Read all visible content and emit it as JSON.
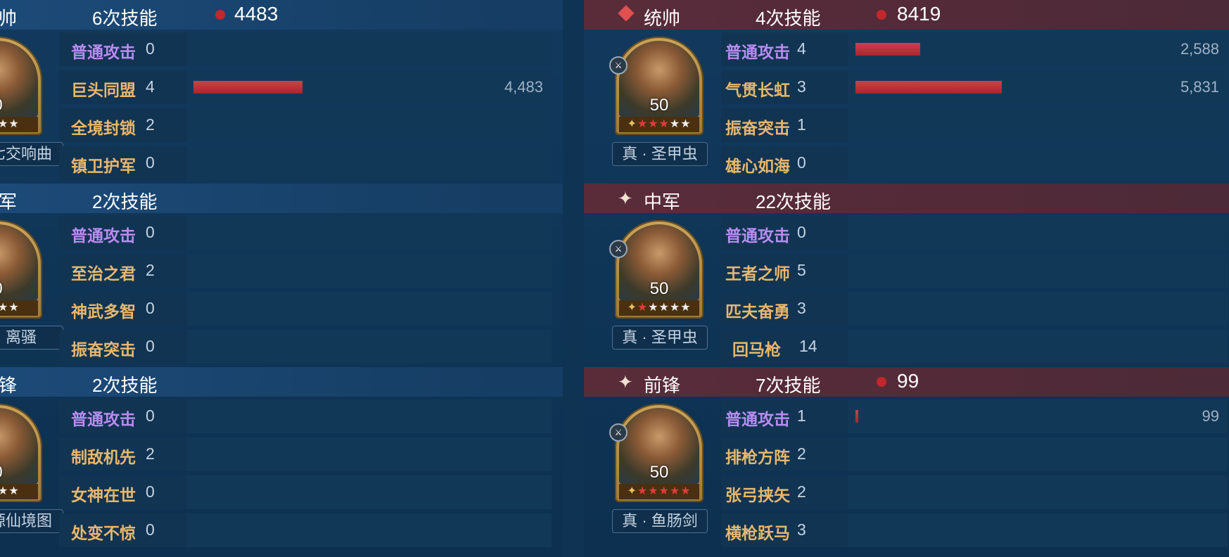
{
  "left": {
    "teams": [
      {
        "role": "帅",
        "skill_count": "6次技能",
        "damage": "4483",
        "level": "0",
        "stars": [
          true,
          true,
          false,
          false
        ],
        "treasure": "七交响曲",
        "skills": [
          {
            "name": "普通攻击",
            "type": "normal",
            "count": "0",
            "bar": 0,
            "value": ""
          },
          {
            "name": "巨头同盟",
            "type": "tactic",
            "count": "4",
            "bar": 0.177,
            "value": "4,483"
          },
          {
            "name": "全境封锁",
            "type": "tactic",
            "count": "2",
            "bar": 0,
            "value": ""
          },
          {
            "name": "镇卫护军",
            "type": "tactic",
            "count": "0",
            "bar": 0,
            "value": ""
          }
        ]
      },
      {
        "role": "军",
        "skill_count": "2次技能",
        "damage": "",
        "level": "0",
        "stars": [
          true,
          true,
          false,
          false
        ],
        "treasure": "离骚",
        "skills": [
          {
            "name": "普通攻击",
            "type": "normal",
            "count": "0",
            "bar": 0,
            "value": ""
          },
          {
            "name": "至治之君",
            "type": "tactic",
            "count": "2",
            "bar": 0,
            "value": ""
          },
          {
            "name": "神武多智",
            "type": "tactic",
            "count": "0",
            "bar": 0,
            "value": ""
          },
          {
            "name": "振奋突击",
            "type": "tactic",
            "count": "0",
            "bar": 0,
            "value": ""
          }
        ]
      },
      {
        "role": "锋",
        "skill_count": "2次技能",
        "damage": "",
        "level": "0",
        "stars": [
          true,
          true,
          false,
          false
        ],
        "treasure": "源仙境图",
        "skills": [
          {
            "name": "普通攻击",
            "type": "normal",
            "count": "0",
            "bar": 0,
            "value": ""
          },
          {
            "name": "制敌机先",
            "type": "tactic",
            "count": "2",
            "bar": 0,
            "value": ""
          },
          {
            "name": "女神在世",
            "type": "tactic",
            "count": "0",
            "bar": 0,
            "value": ""
          },
          {
            "name": "处变不惊",
            "type": "tactic",
            "count": "0",
            "bar": 0,
            "value": ""
          }
        ]
      }
    ]
  },
  "right": {
    "teams": [
      {
        "role": "统帅",
        "skill_count": "4次技能",
        "damage": "8419",
        "icon": "sword-badge-icon",
        "level": "50",
        "stars": [
          false,
          true,
          true,
          true,
          false,
          false
        ],
        "treasure": "真 · 圣甲虫",
        "skills": [
          {
            "name": "普通攻击",
            "type": "normal",
            "count": "4",
            "bar": 0.102,
            "value": "2,588"
          },
          {
            "name": "气贯长虹",
            "type": "tactic",
            "count": "3",
            "bar": 0.23,
            "value": "5,831"
          },
          {
            "name": "振奋突击",
            "type": "tactic",
            "count": "1",
            "bar": 0,
            "value": ""
          },
          {
            "name": "雄心如海",
            "type": "tactic",
            "count": "0",
            "bar": 0,
            "value": ""
          }
        ]
      },
      {
        "role": "中军",
        "skill_count": "22次技能",
        "damage": "",
        "icon": "star-badge-icon",
        "level": "50",
        "stars": [
          false,
          true,
          false,
          false,
          false,
          false
        ],
        "treasure": "真 · 圣甲虫",
        "skills": [
          {
            "name": "普通攻击",
            "type": "normal",
            "count": "0",
            "bar": 0,
            "value": ""
          },
          {
            "name": "王者之师",
            "type": "tactic",
            "count": "5",
            "bar": 0,
            "value": ""
          },
          {
            "name": "匹夫奋勇",
            "type": "tactic",
            "count": "3",
            "bar": 0,
            "value": ""
          },
          {
            "name": "回马枪",
            "type": "tactic",
            "count": "14",
            "bar": 0,
            "value": ""
          }
        ]
      },
      {
        "role": "前锋",
        "skill_count": "7次技能",
        "damage": "99",
        "icon": "star-badge-icon",
        "level": "50",
        "stars": [
          false,
          true,
          true,
          true,
          true,
          true
        ],
        "treasure": "真 · 鱼肠剑",
        "skills": [
          {
            "name": "普通攻击",
            "type": "normal",
            "count": "1",
            "bar": 0.004,
            "value": "99"
          },
          {
            "name": "排枪方阵",
            "type": "tactic",
            "count": "2",
            "bar": 0,
            "value": ""
          },
          {
            "name": "张弓挟矢",
            "type": "tactic",
            "count": "2",
            "bar": 0,
            "value": ""
          },
          {
            "name": "横枪跃马",
            "type": "tactic",
            "count": "3",
            "bar": 0,
            "value": ""
          }
        ]
      }
    ]
  },
  "colors": {
    "normal_skill": "#b88cf0",
    "tactic_skill": "#e8b86a",
    "bar": "#c0282c",
    "blue_header": "#1c4a78",
    "red_header": "#5a2c3a"
  }
}
